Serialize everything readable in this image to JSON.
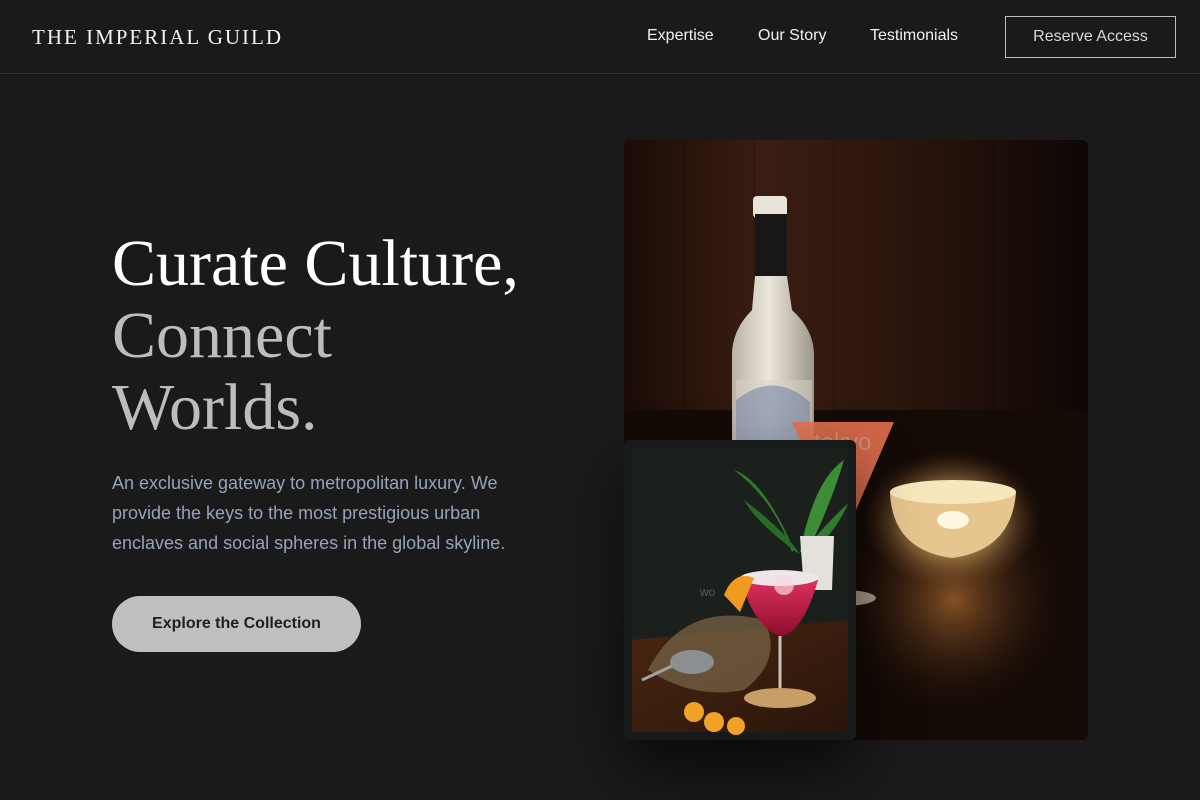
{
  "header": {
    "brand": "THE IMPERIAL GUILD",
    "nav": [
      "Expertise",
      "Our Story",
      "Testimonials"
    ],
    "cta_label": "Reserve Access"
  },
  "hero": {
    "title_line_1": "Curate Culture,",
    "title_line_2": "Connect",
    "title_line_3": "Worlds.",
    "description": "An exclusive gateway to metropolitan luxury. We provide the keys to the most prestigious urban enclaves and social spheres in the global skyline.",
    "button_label": "Explore the Collection"
  },
  "images": {
    "main_watermark": "tokyo",
    "overlay_watermark": "wo"
  },
  "colors": {
    "background": "#1a1a1a",
    "text_primary": "#ffffff",
    "text_muted": "#bdbdbd",
    "text_description": "#97a3b8",
    "button_bg": "#bfbfbf"
  }
}
